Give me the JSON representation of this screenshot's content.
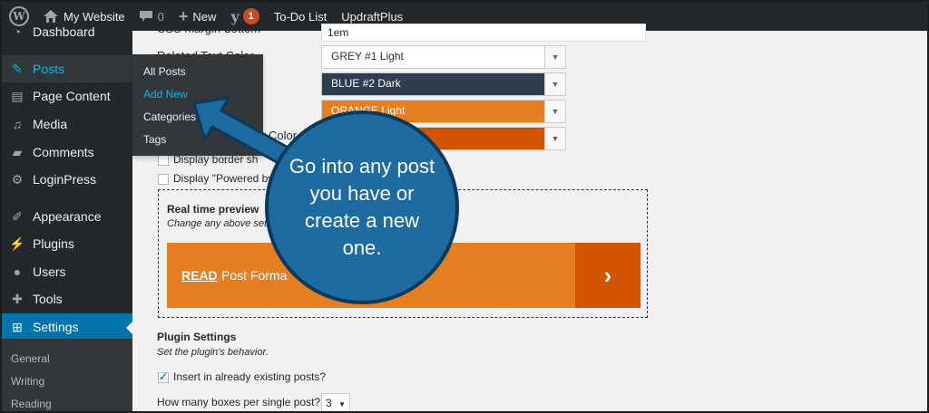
{
  "adminbar": {
    "site_name": "My Website",
    "comments_count": "0",
    "new_label": "New",
    "yoast_badge": "1",
    "todo_label": "To-Do List",
    "updraft_label": "UpdraftPlus"
  },
  "sidebar": {
    "items": [
      {
        "label": "Dashboard",
        "icon": "dashboard-icon"
      },
      {
        "label": "Posts",
        "icon": "pin-icon"
      },
      {
        "label": "Page Content",
        "icon": "pages-icon"
      },
      {
        "label": "Media",
        "icon": "media-icon"
      },
      {
        "label": "Comments",
        "icon": "comment-icon"
      },
      {
        "label": "LoginPress",
        "icon": "gear-icon"
      },
      {
        "label": "Appearance",
        "icon": "brush-icon"
      },
      {
        "label": "Plugins",
        "icon": "plug-icon"
      },
      {
        "label": "Users",
        "icon": "user-icon"
      },
      {
        "label": "Tools",
        "icon": "wrench-icon"
      },
      {
        "label": "Settings",
        "icon": "settings-icon"
      }
    ],
    "submenu": [
      "General",
      "Writing",
      "Reading"
    ]
  },
  "flyout": {
    "items": [
      "All Posts",
      "Add New",
      "Categories",
      "Tags"
    ]
  },
  "content": {
    "css_margin_label": "CSS margin-bottom",
    "css_margin_value": "1em",
    "related_text_label": "Related Text Color",
    "select_values": [
      "GREY #1 Light",
      "BLUE #2 Dark",
      "ORANGE Light",
      ""
    ],
    "color_label_tail": "Color",
    "display_border_label": "Display border sh",
    "display_powered_label": "Display \"Powered by",
    "preview_title": "Real time preview",
    "preview_sub": "Change any above set",
    "banner_read": "READ",
    "banner_text": "Post Forma",
    "banner_arrow": "›",
    "plugin_settings_title": "Plugin Settings",
    "plugin_settings_sub": "Set the plugin's behavior.",
    "insert_existing_label": "Insert in already existing posts?",
    "boxes_per_post_label": "How many boxes per single post?",
    "boxes_per_post_value": "3"
  },
  "callout": {
    "text": "Go into any post you have or create a new one."
  },
  "colors": {
    "adminbar_bg": "#23282d",
    "sidebar_bg": "#23282d",
    "accent_blue": "#0073aa",
    "highlight": "#00b9eb",
    "orange": "#e67e22",
    "dark_orange": "#d35400",
    "navy": "#2c3e50",
    "callout_blue": "#1e6ba1"
  }
}
